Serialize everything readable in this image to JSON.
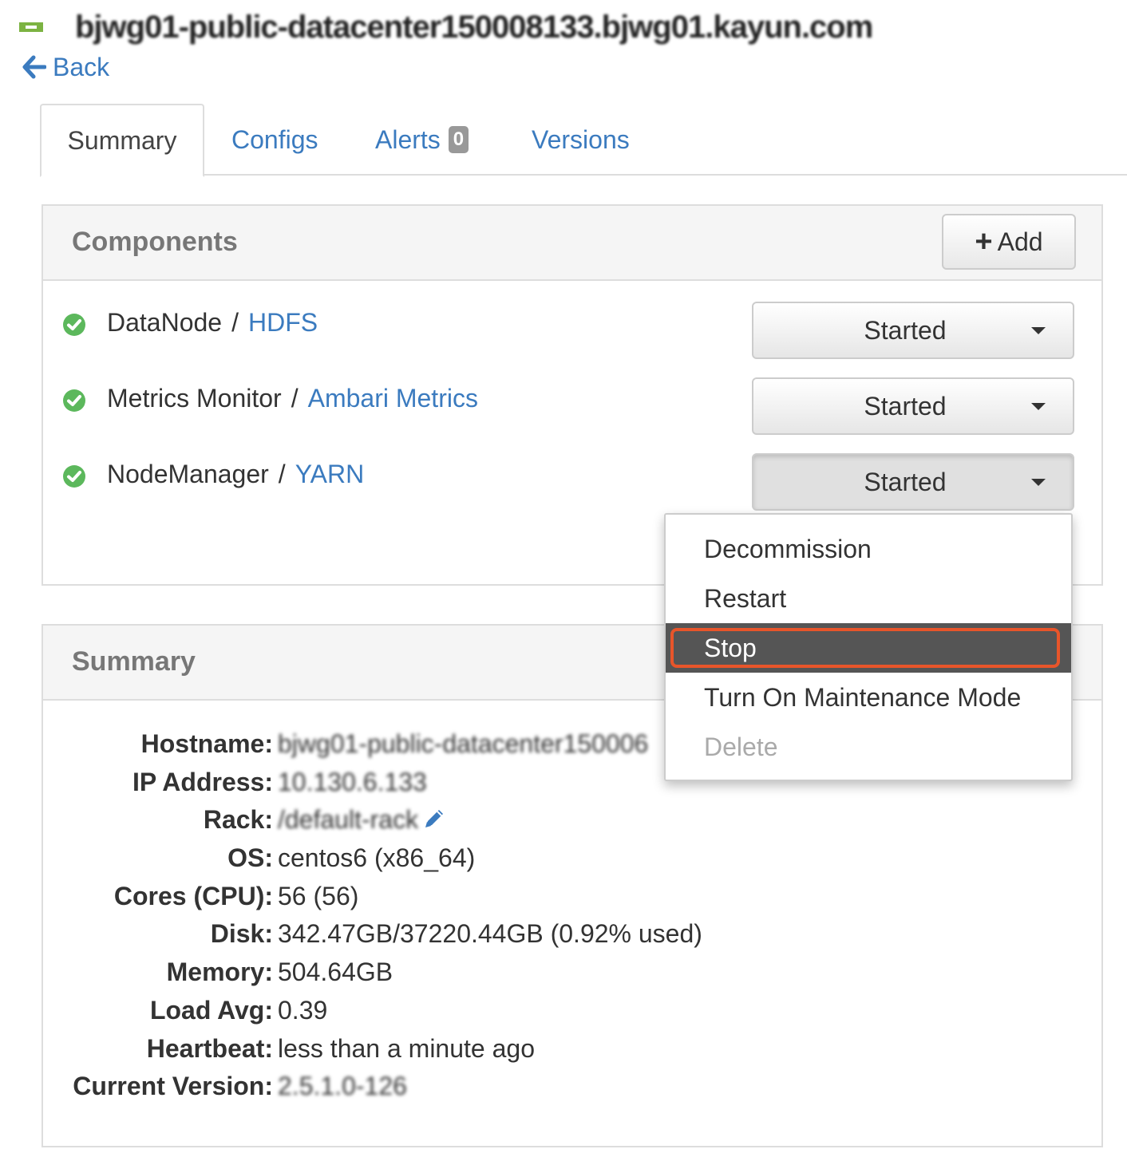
{
  "header": {
    "hostname_title": "bjwg01-public-datacenter150008133.bjwg01.kayun.com",
    "status_color": "#7cb342"
  },
  "nav": {
    "back_label": "Back"
  },
  "tabs": [
    {
      "label": "Summary",
      "active": true
    },
    {
      "label": "Configs"
    },
    {
      "label": "Alerts",
      "badge": "0"
    },
    {
      "label": "Versions"
    }
  ],
  "components_panel": {
    "title": "Components",
    "add_label": "Add",
    "rows": [
      {
        "component": "DataNode",
        "separator": "/",
        "service": "HDFS",
        "state": "Started"
      },
      {
        "component": "Metrics Monitor",
        "separator": "/",
        "service": "Ambari Metrics",
        "state": "Started"
      },
      {
        "component": "NodeManager",
        "separator": "/",
        "service": "YARN",
        "state": "Started"
      }
    ]
  },
  "dropdown_menu": {
    "items": [
      {
        "label": "Decommission"
      },
      {
        "label": "Restart"
      },
      {
        "label": "Stop",
        "highlighted": true
      },
      {
        "label": "Turn On Maintenance Mode"
      },
      {
        "label": "Delete",
        "disabled": true
      }
    ]
  },
  "summary_panel": {
    "title": "Summary",
    "rows": [
      {
        "label": "Hostname:",
        "value": "bjwg01-public-datacenter150006"
      },
      {
        "label": "IP Address:",
        "value": "10.130.6.133"
      },
      {
        "label": "Rack:",
        "value": "/default-rack"
      },
      {
        "label": "OS:",
        "value": "centos6 (x86_64)"
      },
      {
        "label": "Cores (CPU):",
        "value": "56 (56)"
      },
      {
        "label": "Disk:",
        "value": "342.47GB/37220.44GB (0.92% used)"
      },
      {
        "label": "Memory:",
        "value": "504.64GB"
      },
      {
        "label": "Load Avg:",
        "value": "0.39"
      },
      {
        "label": "Heartbeat:",
        "value": "less than a minute ago"
      },
      {
        "label": "Current Version:",
        "value": "2.5.1.0-126"
      }
    ]
  },
  "colors": {
    "link": "#3b7bbf",
    "success": "#5cb85c",
    "menu_highlight": "#555555",
    "callout": "#e8552a"
  }
}
